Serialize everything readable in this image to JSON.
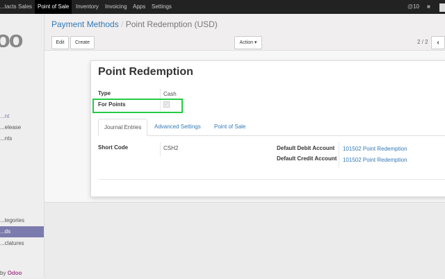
{
  "topbar": {
    "menus": [
      "...tacts",
      "Sales",
      "Point of Sale",
      "Inventory",
      "Invoicing",
      "Apps",
      "Settings"
    ],
    "active": "Point of Sale",
    "notification_count": "10"
  },
  "sidebar": {
    "items": [
      "...nt",
      "...elease",
      "...nts",
      "...tegories",
      "...ds",
      "...clatures"
    ],
    "active_index": 4,
    "powered_by": "by",
    "brand": "Odoo",
    "logo": "odoo"
  },
  "breadcrumb": {
    "parent": "Payment Methods",
    "separator": "/",
    "current": "Point Redemption (USD)"
  },
  "toolbar": {
    "edit": "Edit",
    "create": "Create",
    "action": "Action ▾",
    "pager": "2 / 2",
    "prev": "‹"
  },
  "form": {
    "title": "Point Redemption",
    "type_label": "Type",
    "type_value": "Cash",
    "for_points_label": "For Points",
    "for_points_checked": true,
    "tabs": [
      "Journal Entries",
      "Advanced Settings",
      "Point of Sale"
    ],
    "active_tab": "Journal Entries",
    "short_code_label": "Short Code",
    "short_code_value": "CSH2",
    "debit_label": "Default Debit Account",
    "debit_value": "101502 Point Redemption",
    "credit_label": "Default Credit Account",
    "credit_value": "101502 Point Redemption"
  },
  "colors": {
    "highlight": "#22cc44",
    "link": "#337ab7",
    "sidebar_active": "#7c7bad"
  }
}
